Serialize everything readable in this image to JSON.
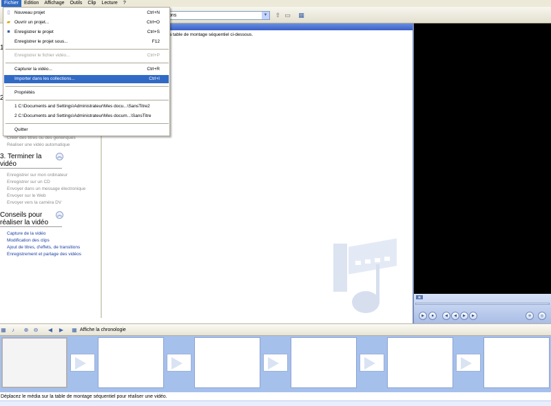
{
  "menubar": {
    "items": [
      "Fichier",
      "Edition",
      "Affichage",
      "Outils",
      "Clip",
      "Lecture",
      "?"
    ]
  },
  "toolbar": {
    "collections_combo_value": "ons"
  },
  "file_menu": {
    "items": [
      {
        "label": "Nouveau projet",
        "shortcut": "Ctrl+N",
        "icon": "new-project-icon"
      },
      {
        "label": "Ouvrir un projet...",
        "shortcut": "Ctrl+O",
        "icon": "open-folder-icon"
      },
      {
        "label": "Enregistrer le projet",
        "shortcut": "Ctrl+S",
        "icon": "save-disk-icon"
      },
      {
        "label": "Enregistrer le projet sous...",
        "shortcut": "F12"
      },
      {
        "label": "Enregistrer le fichier vidéo...",
        "shortcut": "Ctrl+P",
        "disabled": true
      },
      {
        "label": "Capturer la vidéo...",
        "shortcut": "Ctrl+R"
      },
      {
        "label": "Importer dans les collections...",
        "shortcut": "Ctrl+I",
        "highlighted": true
      },
      {
        "label": "Propriétés",
        "shortcut": ""
      },
      {
        "label": "1 C:\\Documents and Settings\\Administrateur\\Mes docu...\\SansTitre2",
        "shortcut": ""
      },
      {
        "label": "2 C:\\Documents and Settings\\Administrateur\\Mes docum...\\SansTitre",
        "shortcut": ""
      },
      {
        "label": "Quitter",
        "shortcut": ""
      }
    ]
  },
  "tasks": {
    "peek_1": "1",
    "peek_2": "2",
    "edit_links": [
      "Créer des titres ou des génériques",
      "Réaliser une vidéo automatique"
    ],
    "finish_section": {
      "title_line1": "3. Terminer la",
      "title_line2": "vidéo",
      "links": [
        "Enregistrer sur mon ordinateur",
        "Enregistrer sur un CD",
        "Envoyer dans un message électronique",
        "Envoyer sur le Web",
        "Envoyer vers la caméra DV"
      ]
    },
    "tips_section": {
      "title_line1": "Conseils pour",
      "title_line2": "réaliser la vidéo",
      "links": [
        "Capture de la vidéo",
        "Modification des clips",
        "Ajout de titres, d'effets, de transitions",
        "Enregistrement et partage des vidéos"
      ]
    }
  },
  "collection": {
    "description": "la table de montage séquentiel ci-dessous."
  },
  "storyboard": {
    "show_timeline_label": "Affiche la chronologie"
  },
  "status": {
    "text": "Déplacez le média sur la table de montage séquentiel pour réaliser une vidéo."
  },
  "colors": {
    "accent": "#316ac5",
    "storyboard_bg": "#a6c0ec",
    "monitor_bg": "#000000",
    "link_blue": "#1a3fa5",
    "link_gray": "#8c8c8c"
  }
}
